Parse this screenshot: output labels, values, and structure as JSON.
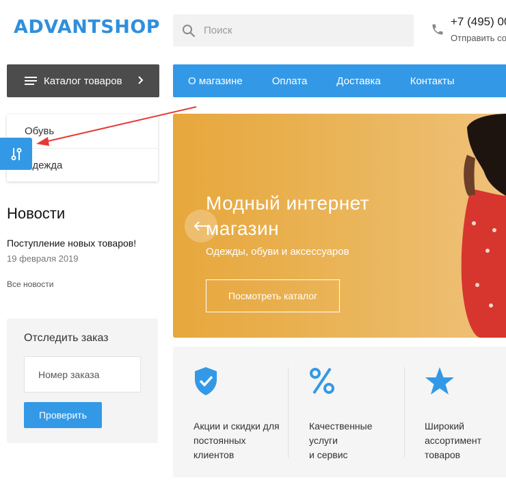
{
  "header": {
    "logo": "ADVANTSHOP",
    "search_placeholder": "Поиск",
    "phone": "+7 (495) 00",
    "callback": "Отправить со"
  },
  "catalog": {
    "button_label": "Каталог товаров",
    "items": [
      "Обувь",
      "Одежда"
    ]
  },
  "nav": {
    "items": [
      "О магазине",
      "Оплата",
      "Доставка",
      "Контакты"
    ]
  },
  "news": {
    "title": "Новости",
    "item_title": "Поступление новых товаров!",
    "item_date": "19 февраля 2019",
    "all_link": "Все новости"
  },
  "track_order": {
    "title": "Отследить заказ",
    "input_placeholder": "Номер заказа",
    "button_label": "Проверить"
  },
  "banner": {
    "title": "Модный интернет магазин",
    "subtitle": "Одежды, обуви и  аксессуаров",
    "button_label": "Посмотреть каталог"
  },
  "features": [
    {
      "icon": "shield-check-icon",
      "lines": [
        "Акции и скидки для",
        "постоянных",
        "клиентов"
      ]
    },
    {
      "icon": "percent-icon",
      "lines": [
        "Качественные",
        "услуги",
        "и сервис"
      ]
    },
    {
      "icon": "star-icon",
      "lines": [
        "Широкий",
        "ассортимент",
        "товаров"
      ]
    }
  ],
  "colors": {
    "accent": "#3399e6",
    "logo": "#2f8fdc",
    "catalog_bg": "#4c4c4c",
    "banner_bg": "#e9ad4b",
    "annotation_arrow": "#e53935"
  }
}
